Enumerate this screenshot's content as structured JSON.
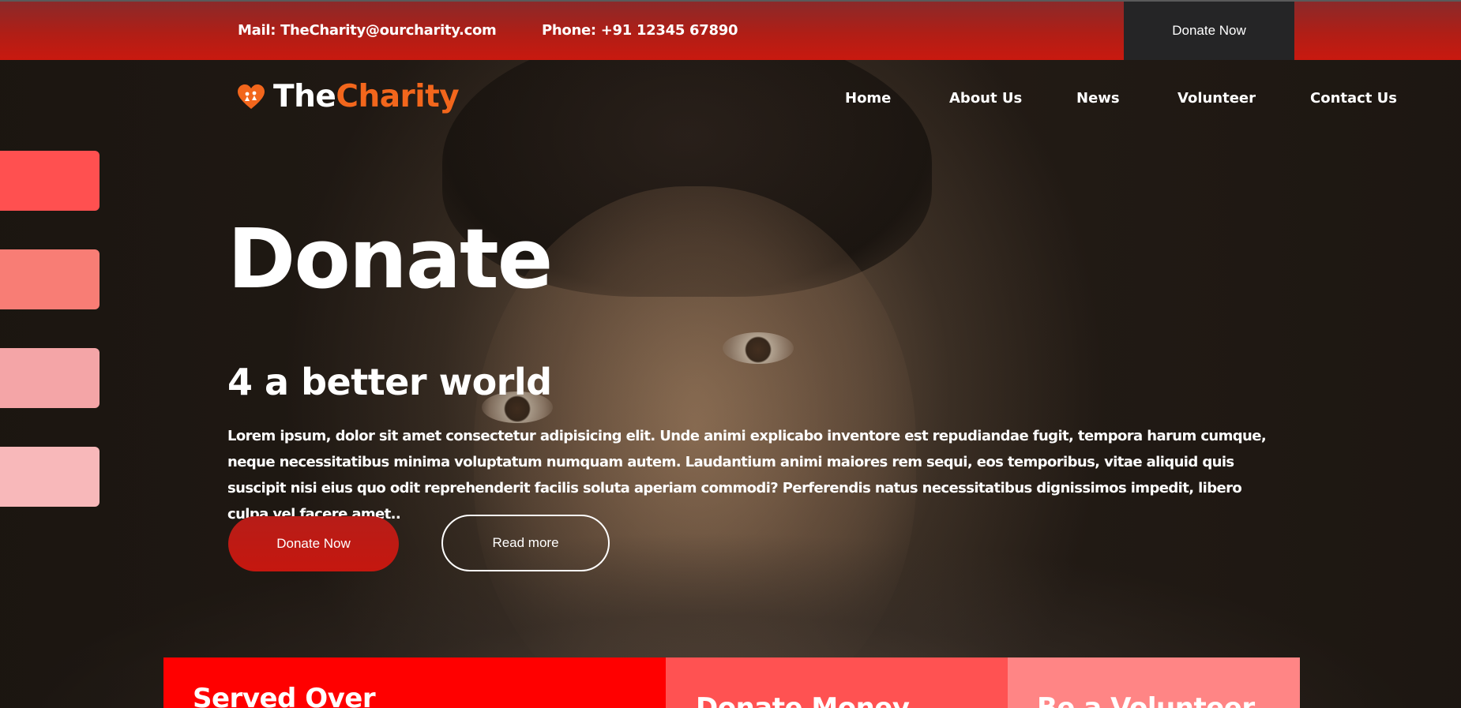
{
  "topbar": {
    "mail": "Mail: TheCharity@ourcharity.com",
    "phone": "Phone: +91 12345 67890",
    "donate_label": "Donate Now"
  },
  "logo": {
    "part1": "The",
    "part2": "Charity"
  },
  "nav": {
    "home": "Home",
    "about": "About Us",
    "news": "News",
    "volunteer": "Volunteer",
    "contact": "Contact Us"
  },
  "swatches": [
    "#ff5050",
    "#f87d75",
    "#f4a5a7",
    "#f8b8ba"
  ],
  "hero": {
    "title": "Donate",
    "subtitle": "4 a better world",
    "body": "Lorem ipsum, dolor sit amet consectetur adipisicing elit. Unde animi explicabo inventore est repudiandae fugit, tempora harum cumque, neque necessitatibus minima voluptatum numquam autem. Laudantium animi maiores rem sequi, eos temporibus, vitae aliquid quis suscipit nisi eius quo odit reprehenderit facilis soluta aperiam commodi? Perferendis natus necessitatibus dignissimos impedit, libero culpa vel facere amet..",
    "donate_label": "Donate Now",
    "read_label": "Read more"
  },
  "cards": [
    {
      "title": "Served Over",
      "color": "#ff0000"
    },
    {
      "title": "Donate Money",
      "color": "#ff5252"
    },
    {
      "title": "Be a Volunteer",
      "color": "#ff8585"
    }
  ],
  "colors": {
    "accent": "#c5170f",
    "logo_orange": "#f2661c",
    "dark_button": "#252526"
  }
}
